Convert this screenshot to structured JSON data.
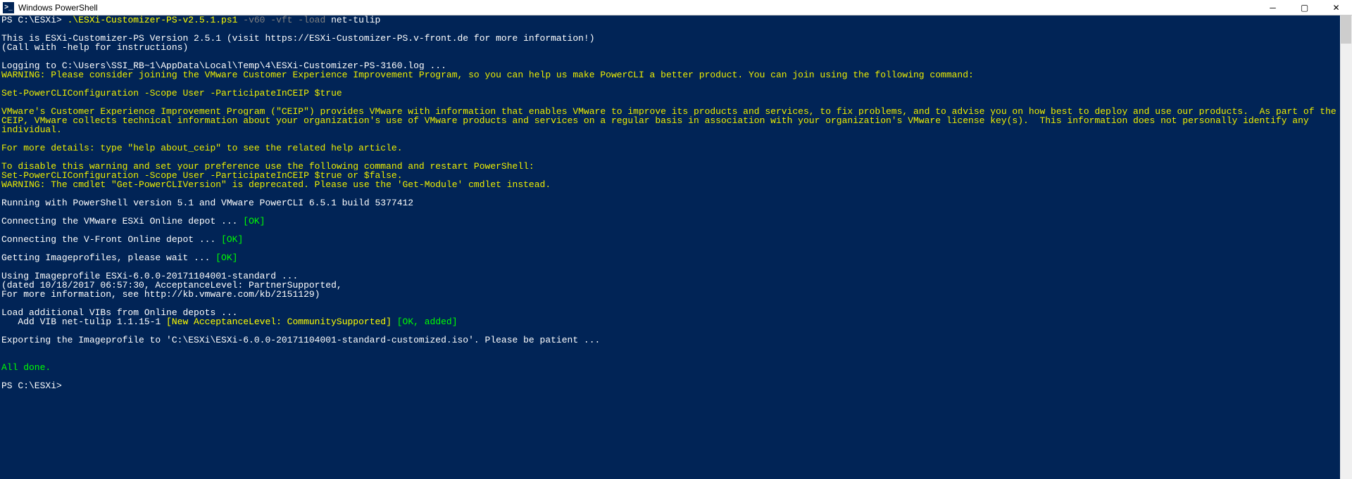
{
  "window": {
    "title": "Windows PowerShell",
    "icon_label": ">_"
  },
  "prompt1": {
    "ps": "PS C:\\ESXi> ",
    "cmd1": ".\\ESXi-Customizer-PS-v2.5.1.ps1",
    "cmd2": " -v60 -vft -load ",
    "cmd3": "net-tulip"
  },
  "blank": "",
  "intro1": "This is ESXi-Customizer-PS Version 2.5.1 (visit https://ESXi-Customizer-PS.v-front.de for more information!)",
  "intro2": "(Call with -help for instructions)",
  "log": "Logging to C:\\Users\\SSI_RB~1\\AppData\\Local\\Temp\\4\\ESXi-Customizer-PS-3160.log ...",
  "warn1": "WARNING: Please consider joining the VMware Customer Experience Improvement Program, so you can help us make PowerCLI a better product. You can join using the following command:",
  "warn2": "Set-PowerCLIConfiguration -Scope User -ParticipateInCEIP $true",
  "warn3": "VMware's Customer Experience Improvement Program (\"CEIP\") provides VMware with information that enables VMware to improve its products and services, to fix problems, and to advise you on how best to deploy and use our products.  As part of the CEIP, VMware collects technical information about your organization's use of VMware products and services on a regular basis in association with your organization's VMware license key(s).  This information does not personally identify any individual.",
  "warn4": "For more details: type \"help about_ceip\" to see the related help article.",
  "warn5": "To disable this warning and set your preference use the following command and restart PowerShell:",
  "warn6": "Set-PowerCLIConfiguration -Scope User -ParticipateInCEIP $true or $false.",
  "warn7": "WARNING: The cmdlet \"Get-PowerCLIVersion\" is deprecated. Please use the 'Get-Module' cmdlet instead.",
  "running": "Running with PowerShell version 5.1 and VMware PowerCLI 6.5.1 build 5377412",
  "conn1_label": "Connecting the VMware ESXi Online depot ... ",
  "conn1_ok": "[OK]",
  "conn2_label": "Connecting the V-Front Online depot ... ",
  "conn2_ok": "[OK]",
  "getimg_label": "Getting Imageprofiles, please wait ... ",
  "getimg_ok": "[OK]",
  "using1": "Using Imageprofile ESXi-6.0.0-20171104001-standard ...",
  "using2": "(dated 10/18/2017 06:57:30, AcceptanceLevel: PartnerSupported,",
  "using3": "For more information, see http://kb.vmware.com/kb/2151129)",
  "load1": "Load additional VIBs from Online depots ...",
  "load2_pre": "   Add VIB net-tulip 1.1.15-1 ",
  "load2_mid": "[New AcceptanceLevel: CommunitySupported]",
  "load2_sep": " ",
  "load2_ok": "[OK, added]",
  "export": "Exporting the Imageprofile to 'C:\\ESXi\\ESXi-6.0.0-20171104001-standard-customized.iso'. Please be patient ...",
  "done": "All done.",
  "prompt2": "PS C:\\ESXi>"
}
